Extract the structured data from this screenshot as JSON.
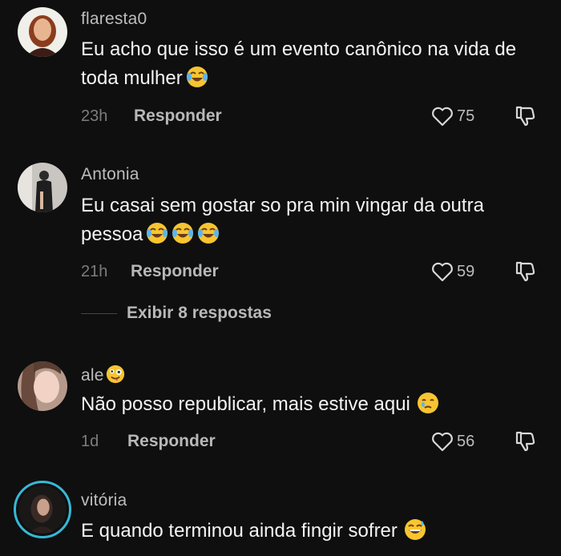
{
  "comments": [
    {
      "username": "flaresta0",
      "text": "Eu acho que isso é um evento canônico na vida de toda mulher",
      "time": "23h",
      "reply_label": "Responder",
      "likes": "75",
      "emojis": [
        "face-with-tears-of-joy"
      ]
    },
    {
      "username": "Antonia",
      "text": "Eu casai sem gostar so pra min vingar da outra pessoa",
      "time": "21h",
      "reply_label": "Responder",
      "likes": "59",
      "emojis": [
        "face-with-tears-of-joy",
        "face-with-tears-of-joy",
        "face-with-tears-of-joy"
      ],
      "view_replies_label": "Exibir 8 respostas"
    },
    {
      "username": "ale",
      "text": "Não posso republicar, mais estive aqui",
      "time": "1d",
      "reply_label": "Responder",
      "likes": "56",
      "emojis": [
        "zany-face",
        "face-holding-back-tears"
      ]
    },
    {
      "username": "vitória",
      "text": "E quando terminou ainda fingir sofrer",
      "emojis": [
        "grinning-face-with-sweat"
      ],
      "has_story_ring": true
    }
  ],
  "colors": {
    "background": "#0f0f10",
    "story_ring": "#35b9d6"
  },
  "icons": [
    "heart-outline-icon",
    "thumbs-down-icon"
  ]
}
